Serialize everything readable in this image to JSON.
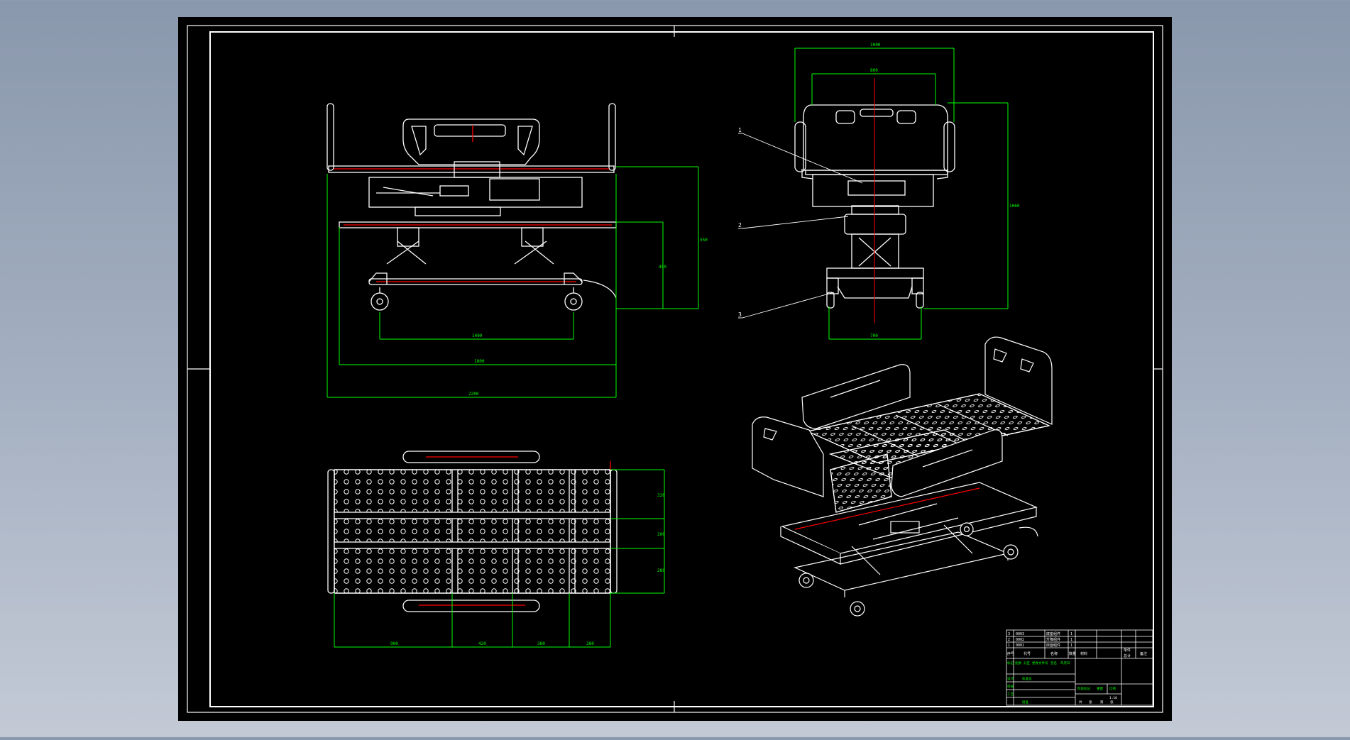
{
  "colors": {
    "background": "#8a98ad",
    "sheet": "#000000",
    "frame": "#ffffff",
    "outline": "#ffffff",
    "dimension": "#00ff00",
    "centerline": "#ff0000",
    "table_text": "#ffffff",
    "table_label": "#00ff00"
  },
  "views": {
    "side": {
      "dims": [
        "2200",
        "1800",
        "1400",
        "550",
        "450"
      ]
    },
    "end": {
      "dims": [
        "1000",
        "800",
        "1060",
        "700"
      ],
      "callouts": [
        "1",
        "2",
        "3"
      ]
    },
    "top": {
      "dims_bottom": [
        "900",
        "420",
        "380",
        "280"
      ],
      "dims_right": [
        "320",
        "200",
        "280"
      ]
    }
  },
  "title_block": {
    "parts": [
      {
        "no": "3",
        "code": "0003",
        "name": "底座组件",
        "qty": "1"
      },
      {
        "no": "2",
        "code": "0002",
        "name": "升降组件",
        "qty": "1"
      },
      {
        "no": "1",
        "code": "0001",
        "name": "床面组件",
        "qty": "1"
      }
    ],
    "headers": [
      "序号",
      "代号",
      "名称",
      "数量",
      "材料",
      "单件",
      "总计",
      "备注"
    ],
    "sign_labels": [
      "标记",
      "处数",
      "分区",
      "更改文件号",
      "签名",
      "年月日"
    ],
    "role_labels": [
      "设计",
      "标准化",
      "审核",
      "工艺",
      "批准"
    ],
    "stage_labels": [
      "阶段标记",
      "重量",
      "比例"
    ],
    "scale": "1:10",
    "sheet_labels": [
      "共",
      "张",
      "第",
      "张"
    ]
  }
}
